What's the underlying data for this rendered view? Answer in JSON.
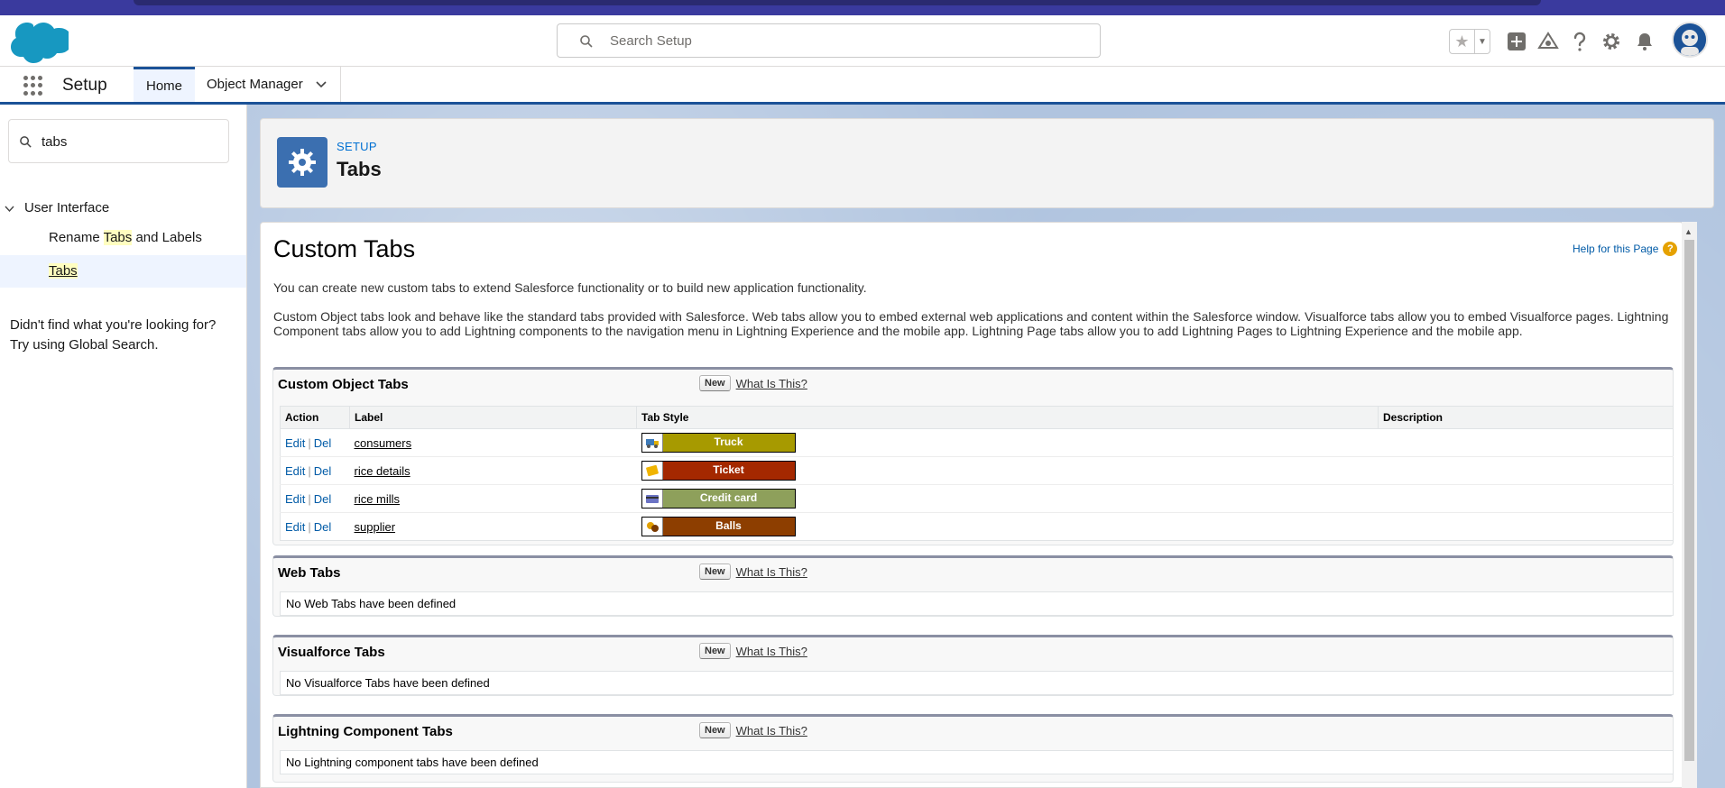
{
  "global_search": {
    "placeholder": "Search Setup"
  },
  "app_nav": {
    "app_name": "Setup",
    "tabs": [
      {
        "label": "Home"
      },
      {
        "label": "Object Manager"
      }
    ]
  },
  "sidebar": {
    "quick_find_value": "tabs",
    "node": {
      "label": "User Interface"
    },
    "items": [
      {
        "pre": "Rename ",
        "highlight": "Tabs",
        "post": " and Labels"
      },
      {
        "pre": "",
        "highlight": "Tabs",
        "post": ""
      }
    ],
    "help_line1": "Didn't find what you're looking for?",
    "help_line2": "Try using Global Search."
  },
  "page_header": {
    "eyebrow": "SETUP",
    "title": "Tabs"
  },
  "content": {
    "title": "Custom Tabs",
    "help_link": "Help for this Page",
    "help_icon": "?",
    "intro": "You can create new custom tabs to extend Salesforce functionality or to build new application functionality.",
    "intro2": "Custom Object tabs look and behave like the standard tabs provided with Salesforce. Web tabs allow you to embed external web applications and content within the Salesforce window. Visualforce tabs allow you to embed Visualforce pages. Lightning Component tabs allow you to add Lightning components to the navigation menu in Lightning Experience and the mobile app. Lightning Page tabs allow you to add Lightning Pages to Lightning Experience and the mobile app."
  },
  "buttons": {
    "new_label": "New",
    "what_label": "What Is This?"
  },
  "custom_object_tabs": {
    "title": "Custom Object Tabs",
    "columns": [
      "Action",
      "Label",
      "Tab Style",
      "Description"
    ],
    "action_edit": "Edit",
    "action_sep": "|",
    "action_del": "Del",
    "rows": [
      {
        "label": "consumers",
        "style": "Truck",
        "color": "#a79a00",
        "icon": "truck-icon"
      },
      {
        "label": "rice details",
        "style": "Ticket",
        "color": "#a42800",
        "icon": "ticket-icon"
      },
      {
        "label": "rice mills",
        "style": "Credit card",
        "color": "#8ea05b",
        "icon": "credit-card-icon"
      },
      {
        "label": "supplier",
        "style": "Balls",
        "color": "#8d3e00",
        "icon": "balls-icon"
      }
    ]
  },
  "web_tabs": {
    "title": "Web Tabs",
    "empty": "No Web Tabs have been defined"
  },
  "visualforce_tabs": {
    "title": "Visualforce Tabs",
    "empty": "No Visualforce Tabs have been defined"
  },
  "lightning_component_tabs": {
    "title": "Lightning Component Tabs",
    "empty": "No Lightning component tabs have been defined"
  },
  "colors": {
    "brand": "#1b5297",
    "setup_icon_bg": "#3b6fb0",
    "link": "#015ba7"
  }
}
